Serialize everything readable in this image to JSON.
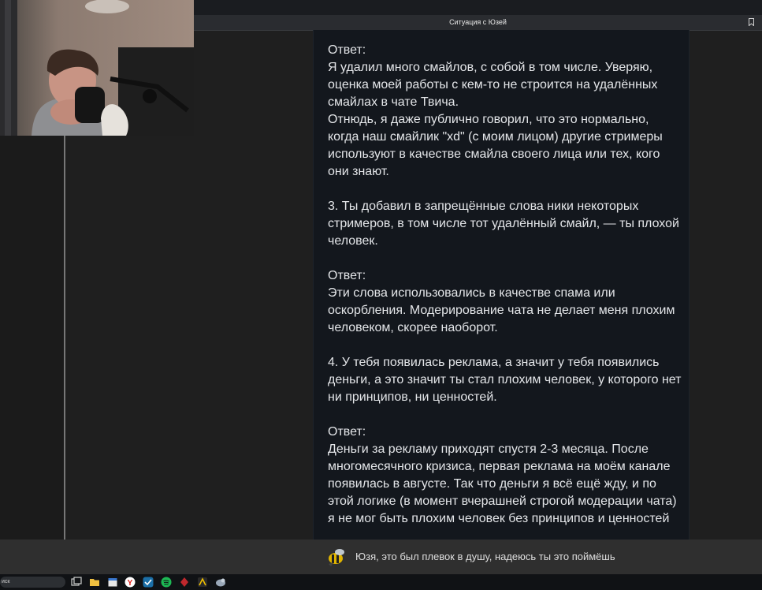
{
  "browser": {
    "tab_title": "Ситуация с Юзей",
    "bookmark_icon": "bookmark-icon"
  },
  "webcam": {
    "description_icon": "streamer-webcam"
  },
  "article": {
    "paragraphs": [
      "Ответ:\nЯ удалил много смайлов, с собой в том числе. Уверяю, оценка моей работы с кем-то не строится на удалённых смайлах в чате Твича.\nОтнюдь, я даже публично говорил, что это нормально, когда наш смайлик \"xd\" (с моим лицом) другие стримеры используют в качестве смайла своего лица или тех, кого они знают.",
      "3. Ты добавил в запрещённые слова ники некоторых стримеров, в том числе тот удалённый смайл, — ты плохой человек.",
      "Ответ:\nЭти слова использовались в качестве спама или оскорбления. Модерирование чата не делает меня плохим человеком, скорее наоборот.",
      "4. У тебя появилась реклама, а значит у тебя появились деньги, а это значит ты стал плохим человек, у которого нет ни принципов, ни ценностей.",
      "Ответ:\nДеньги за рекламу приходят спустя 2-3 месяца. После многомесячного кризиса, первая реклама на моём канале появилась в августе. Так что деньги я всё ещё жду, и по этой логике (в момент вчерашней строгой модерации чата) я не мог быть плохим человек без принципов и ценностей"
    ]
  },
  "overlay": {
    "message": "Юзя, это был плевок в душу, надеюсь ты это поймёшь",
    "icon": "bee-icon"
  },
  "taskbar": {
    "search_text": "иск",
    "icons": [
      "task-view-icon",
      "file-explorer-icon",
      "calendar-icon",
      "yandex-icon",
      "steam-icon",
      "spotify-icon",
      "app-red-icon",
      "app-dark-icon",
      "app-bird-icon"
    ]
  },
  "colors": {
    "article_bg": "#13171d",
    "text": "#e4e6e9",
    "overlay_bg": "#2f2f2f"
  }
}
